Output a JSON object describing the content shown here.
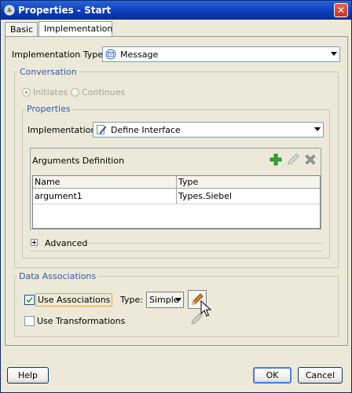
{
  "window": {
    "title": "Properties - Start"
  },
  "tabs": [
    {
      "label": "Basic",
      "active": false
    },
    {
      "label": "Implementation",
      "active": true
    }
  ],
  "implementation_type": {
    "label": "Implementation Type:",
    "value": "Message"
  },
  "conversation": {
    "title": "Conversation",
    "options": [
      {
        "label": "Initiates",
        "selected": true
      },
      {
        "label": "Continues",
        "selected": false
      }
    ]
  },
  "properties": {
    "title": "Properties",
    "implementation_label": "Implementation:",
    "implementation_value": "Define Interface",
    "arguments": {
      "title": "Arguments Definition",
      "columns": [
        "Name",
        "Type"
      ],
      "rows": [
        {
          "name": "argument1",
          "type": "Types.Siebel"
        }
      ]
    },
    "advanced_label": "Advanced"
  },
  "data_associations": {
    "title": "Data Associations",
    "use_associations": {
      "label": "Use Associations",
      "checked": true
    },
    "type_label": "Type:",
    "type_value": "Simple",
    "use_transformations": {
      "label": "Use Transformations",
      "checked": false
    }
  },
  "footer": {
    "help": "Help",
    "ok": "OK",
    "cancel": "Cancel"
  },
  "colors": {
    "titlebar": "#0a3bb8",
    "group_title": "#2f5aa8",
    "add_icon": "#2fa62f",
    "highlight_border": "#e8a33a"
  },
  "icons": [
    "app-icon",
    "close-icon",
    "message-icon",
    "define-interface-icon",
    "add-icon",
    "edit-icon",
    "delete-icon",
    "expand-icon",
    "pencil-icon",
    "mouse-cursor-icon"
  ]
}
